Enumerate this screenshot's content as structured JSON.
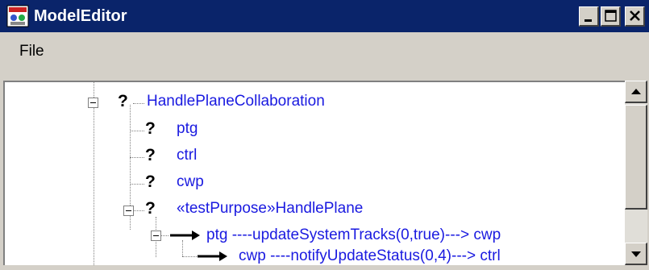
{
  "window": {
    "title": "ModelEditor",
    "controls": {
      "minimize_icon": "minimize-icon",
      "maximize_icon": "maximize-icon",
      "close_icon": "close-icon"
    },
    "colors": {
      "titlebar": "#0a246a",
      "node_text": "#1a1ae0",
      "chrome": "#d4d0c8"
    }
  },
  "menu": {
    "file": "File"
  },
  "tree": {
    "nodes": [
      {
        "icon": "question-icon",
        "label": "HandlePlaneCollaboration"
      },
      {
        "icon": "question-icon",
        "label": "ptg"
      },
      {
        "icon": "question-icon",
        "label": "ctrl"
      },
      {
        "icon": "question-icon",
        "label": "cwp"
      },
      {
        "icon": "question-icon",
        "label": "«testPurpose»HandlePlane"
      },
      {
        "icon": "arrow-icon",
        "label": "ptg ----updateSystemTracks(0,true)---> cwp"
      },
      {
        "icon": "arrow-icon",
        "label": "cwp ----notifyUpdateStatus(0,4)---> ctrl"
      }
    ]
  },
  "icons": {
    "question_glyph": "?"
  }
}
